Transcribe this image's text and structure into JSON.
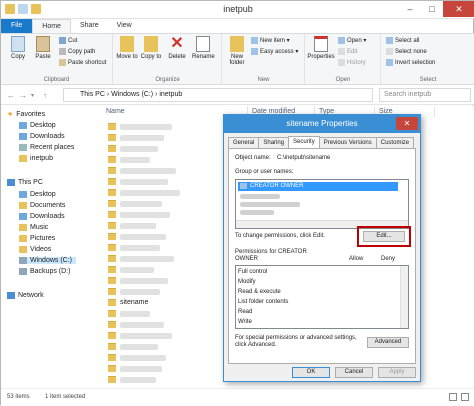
{
  "window": {
    "title": "inetpub",
    "controls": [
      "–",
      "□",
      "✕"
    ]
  },
  "ribbon_tabs": [
    "File",
    "Home",
    "Share",
    "View"
  ],
  "ribbon": {
    "clipboard": {
      "copy": "Copy",
      "paste": "Paste",
      "cut": "Cut",
      "copy_path": "Copy path",
      "paste_shortcut": "Paste shortcut",
      "label": "Clipboard"
    },
    "organize": {
      "move_to": "Move to",
      "copy_to": "Copy to",
      "delete": "Delete",
      "rename": "Rename",
      "label": "Organize"
    },
    "new": {
      "new_folder": "New folder",
      "new_item": "New item ▾",
      "easy_access": "Easy access ▾",
      "label": "New"
    },
    "open": {
      "properties": "Properties",
      "open": "Open ▾",
      "edit": "Edit",
      "history": "History",
      "label": "Open"
    },
    "select": {
      "select_all": "Select all",
      "select_none": "Select none",
      "invert": "Invert selection",
      "label": "Select"
    }
  },
  "address": {
    "path": "This PC  ›  Windows (C:)  ›  inetpub",
    "search_placeholder": "Search inetpub"
  },
  "nav": {
    "favorites": "Favorites",
    "fav_items": [
      "Desktop",
      "Downloads",
      "Recent places",
      "inetpub"
    ],
    "this_pc": "This PC",
    "pc_items": [
      "Desktop",
      "Documents",
      "Downloads",
      "Music",
      "Pictures",
      "Videos",
      "Windows (C:)",
      "Backups (D:)"
    ],
    "network": "Network"
  },
  "columns": {
    "name": "Name",
    "date": "Date modified",
    "type": "Type",
    "size": "Size"
  },
  "files": {
    "selected_name": "sitename"
  },
  "status": {
    "items": "53 items",
    "selected": "1 item selected"
  },
  "dialog": {
    "title": "sitename Properties",
    "close": "✕",
    "tabs": [
      "General",
      "Sharing",
      "Security",
      "Previous Versions",
      "Customize"
    ],
    "object_name_label": "Object name:",
    "object_name_value": "C:\\inetpub\\sitename",
    "group_label": "Group or user names:",
    "group_selected": "CREATOR OWNER",
    "change_text": "To change permissions, click Edit.",
    "edit_button": "Edit...",
    "perm_label_line1": "Permissions for CREATOR",
    "perm_label_line2": "OWNER",
    "allow": "Allow",
    "deny": "Deny",
    "permissions": [
      "Full control",
      "Modify",
      "Read & execute",
      "List folder contents",
      "Read",
      "Write"
    ],
    "special_text_line1": "For special permissions or advanced settings,",
    "special_text_line2": "click Advanced.",
    "advanced_button": "Advanced",
    "ok": "OK",
    "cancel": "Cancel",
    "apply": "Apply"
  },
  "colors": {
    "accent": "#1979ca",
    "folder": "#e8c25a",
    "highlight": "#c00000",
    "selection": "#3399ff"
  }
}
